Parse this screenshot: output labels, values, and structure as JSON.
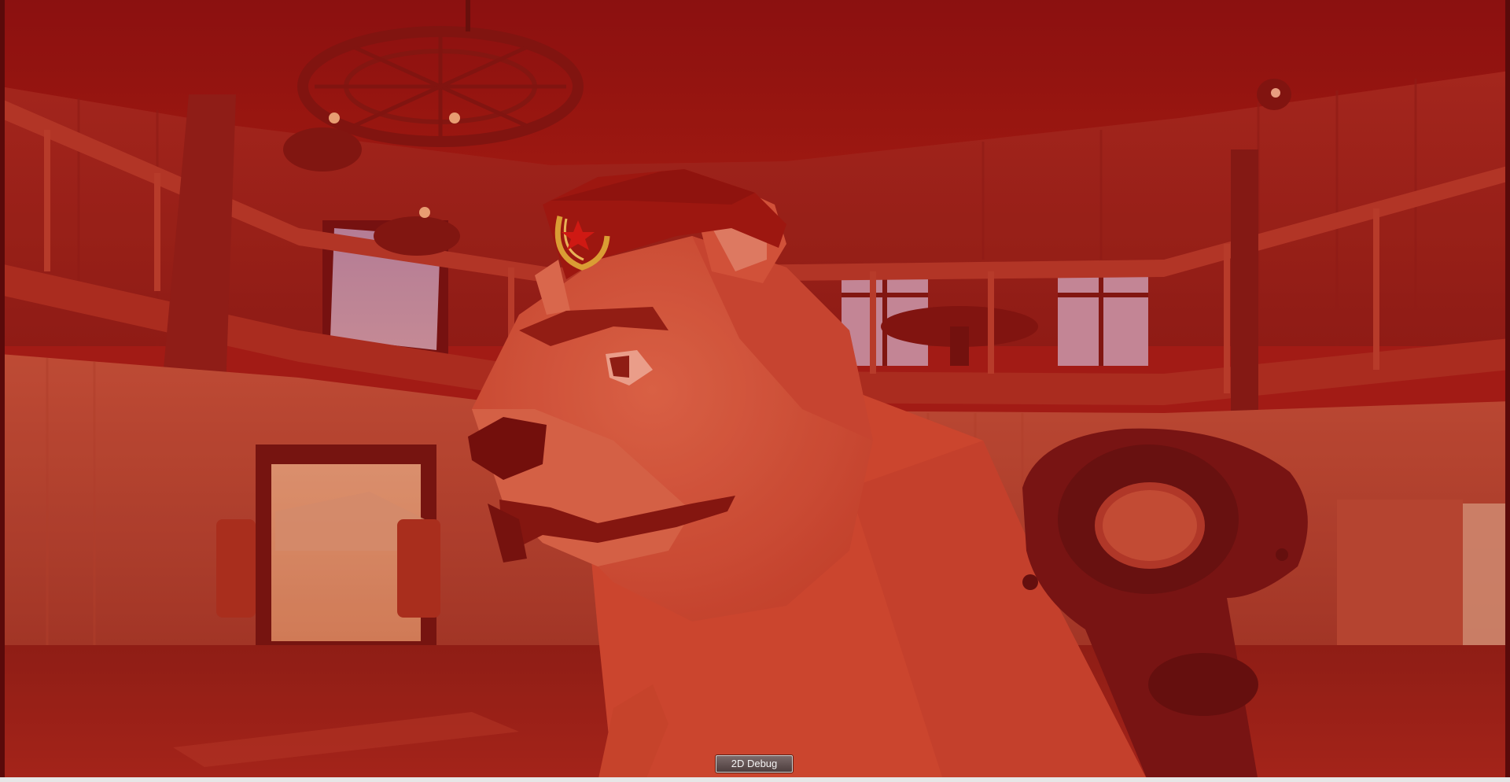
{
  "app": {
    "view": "vr-mirror-viewport"
  },
  "scene": {
    "tint_color": "#b81a14",
    "ceiling_color": "#8e1210",
    "wall_color": "#a3261e",
    "bear_color": "#d4533a",
    "hat_color": "#9e1a12",
    "emblem_color": "#e0b03a",
    "window_color": "#c08aa0",
    "controller_color": "#6e1414"
  },
  "debug": {
    "button_label": "2D Debug"
  }
}
